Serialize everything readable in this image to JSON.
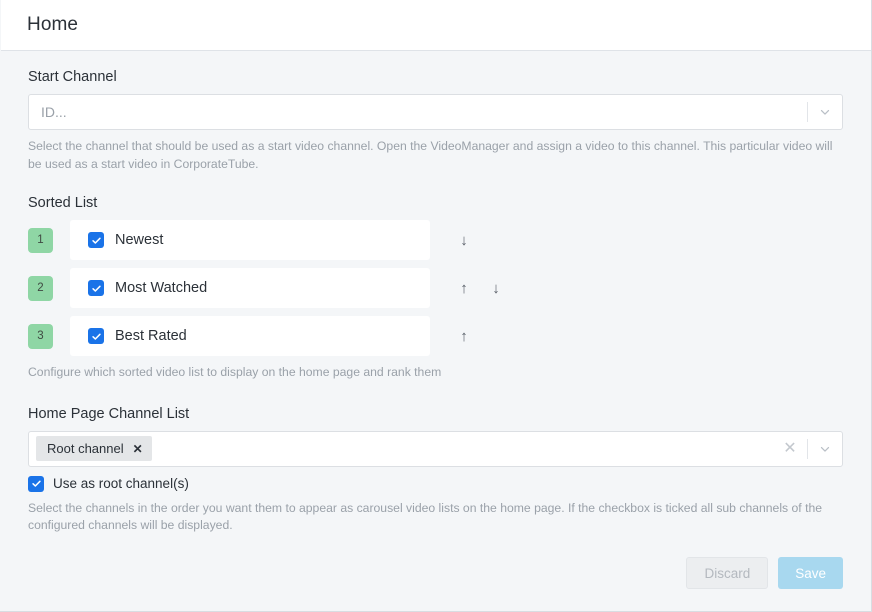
{
  "header": {
    "title": "Home"
  },
  "start_channel": {
    "label": "Start Channel",
    "placeholder": "ID...",
    "value": "",
    "chevron_icon": "chevron-down-icon",
    "help": "Select the channel that should be used as a start video channel. Open the VideoManager and assign a video to this channel. This particular video will be used as a start video in CorporateTube."
  },
  "sorted_list": {
    "label": "Sorted List",
    "help": "Configure which sorted video list to display on the home page and rank them",
    "up_arrow": "↑",
    "down_arrow": "↓",
    "items": [
      {
        "rank": "1",
        "label": "Newest",
        "checked": true,
        "has_up": false,
        "has_down": true
      },
      {
        "rank": "2",
        "label": "Most Watched",
        "checked": true,
        "has_up": true,
        "has_down": true
      },
      {
        "rank": "3",
        "label": "Best Rated",
        "checked": true,
        "has_up": true,
        "has_down": false
      }
    ]
  },
  "channel_list": {
    "label": "Home Page Channel List",
    "tags": [
      {
        "label": "Root channel",
        "remove_icon": "✕"
      }
    ],
    "clear_icon": "✕",
    "chevron_icon": "chevron-down-icon",
    "root_checkbox": {
      "label": "Use as root channel(s)",
      "checked": true
    },
    "help": "Select the channels in the order you want them to appear as carousel video lists on the home page. If the checkbox is ticked all sub channels of the configured channels will be displayed."
  },
  "footer": {
    "discard_label": "Discard",
    "save_label": "Save"
  },
  "colors": {
    "rank_badge_green": "#8fd6a5",
    "checkbox_blue": "#1a73e8",
    "save_blue": "#a8d8ef",
    "body_bg": "#f4f6f8"
  }
}
